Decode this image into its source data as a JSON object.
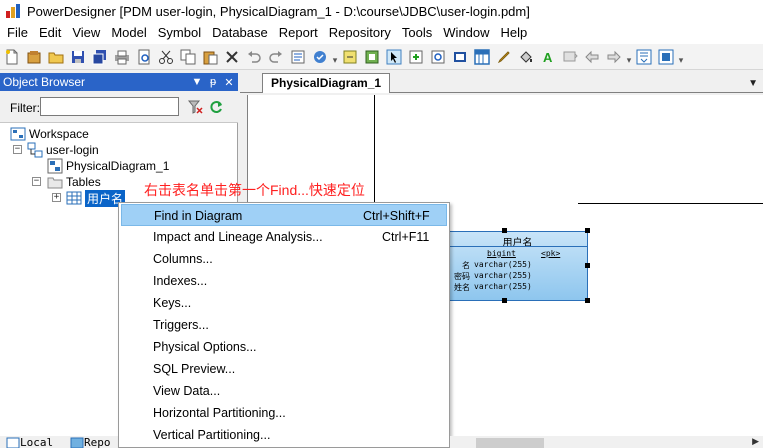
{
  "window": {
    "title": "PowerDesigner [PDM user-login, PhysicalDiagram_1 - D:\\course\\JDBC\\user-login.pdm]"
  },
  "menubar": {
    "items": [
      "File",
      "Edit",
      "View",
      "Model",
      "Symbol",
      "Database",
      "Report",
      "Repository",
      "Tools",
      "Window",
      "Help"
    ]
  },
  "toolbar": {
    "icons": [
      "new-model-icon",
      "new-project-icon",
      "open-icon",
      "save-icon",
      "save-all-icon",
      "print-icon",
      "print-preview-icon",
      "cut-icon",
      "copy-icon",
      "paste-icon",
      "delete-icon",
      "undo-icon",
      "redo-icon",
      "properties-icon",
      "check-model-icon",
      "generate-icon",
      "repository-icon",
      "pointer-icon",
      "grabber-icon",
      "zoom-in-icon",
      "zoom-out-icon",
      "lasso-icon",
      "table-tool-icon",
      "view-tool-icon",
      "reference-tool-icon",
      "package-tool-icon",
      "line-tool-icon",
      "text-tool-icon",
      "pencil-icon",
      "fill-icon",
      "font-color-icon",
      "align-icon",
      "back-icon",
      "forward-icon",
      "more-icon"
    ]
  },
  "object_browser": {
    "title": "Object Browser",
    "filter_label": "Filter:",
    "filter_value": "",
    "tree": {
      "workspace": "Workspace",
      "model": "user-login",
      "diagram": "PhysicalDiagram_1",
      "tables_folder": "Tables",
      "selected_table": "用户名"
    },
    "bottom_tabs": [
      "Local",
      "Repo"
    ]
  },
  "document": {
    "tab_label": "PhysicalDiagram_1"
  },
  "table_symbol": {
    "name": "用户名",
    "columns": [
      {
        "name": "",
        "type": "bigint",
        "key": "<pk>"
      },
      {
        "name": "名",
        "type": "varchar(255)",
        "key": ""
      },
      {
        "name": "密码",
        "type": "varchar(255)",
        "key": ""
      },
      {
        "name": "姓名",
        "type": "varchar(255)",
        "key": ""
      }
    ]
  },
  "annotation": {
    "text": "右击表名单击第一个Find...快速定位",
    "color": "#ff2020"
  },
  "context_menu": {
    "items": [
      {
        "label": "Find in Diagram",
        "shortcut": "Ctrl+Shift+F",
        "highlighted": true
      },
      {
        "label": "Impact and Lineage Analysis...",
        "shortcut": "Ctrl+F11",
        "highlighted": false
      },
      {
        "label": "Columns...",
        "shortcut": "",
        "highlighted": false
      },
      {
        "label": "Indexes...",
        "shortcut": "",
        "highlighted": false
      },
      {
        "label": "Keys...",
        "shortcut": "",
        "highlighted": false
      },
      {
        "label": "Triggers...",
        "shortcut": "",
        "highlighted": false
      },
      {
        "label": "Physical Options...",
        "shortcut": "",
        "highlighted": false
      },
      {
        "label": "SQL Preview...",
        "shortcut": "",
        "highlighted": false
      },
      {
        "label": "View Data...",
        "shortcut": "",
        "highlighted": false
      },
      {
        "label": "Horizontal Partitioning...",
        "shortcut": "",
        "highlighted": false
      },
      {
        "label": "Vertical Partitioning...",
        "shortcut": "",
        "highlighted": false
      }
    ]
  },
  "colors": {
    "panel_header": "#2a64c8",
    "selection": "#0a64c8",
    "menu_highlight": "#9fd0f6",
    "table_fill": "#8ec6ee"
  }
}
